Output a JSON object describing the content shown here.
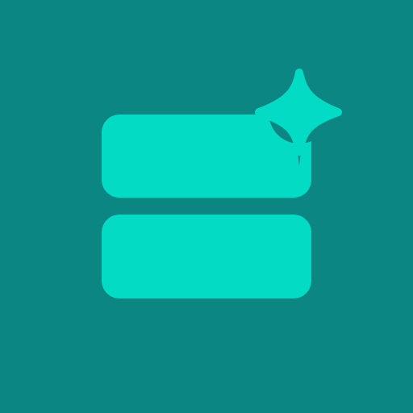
{
  "icon": {
    "name": "stacked-cards-sparkle-icon",
    "colors": {
      "background": "#0b8682",
      "foreground": "#03dbc5"
    }
  }
}
